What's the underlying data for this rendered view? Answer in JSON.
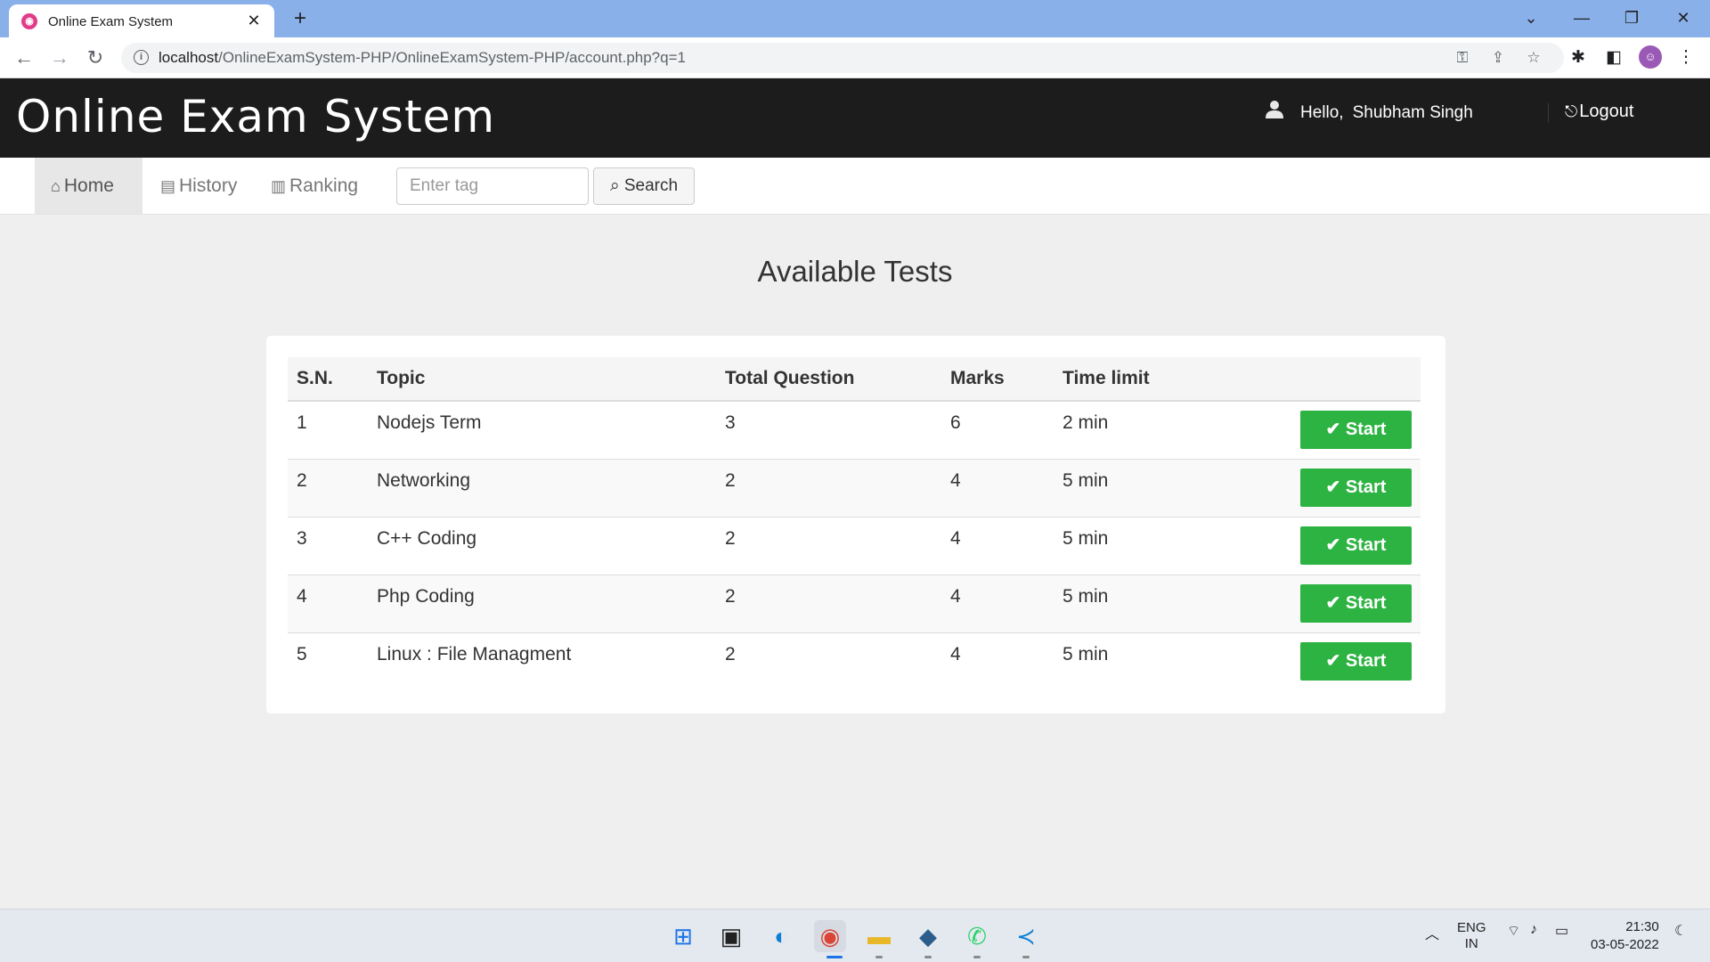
{
  "browser": {
    "tab_title": "Online Exam System",
    "tab_close": "✕",
    "new_tab": "+",
    "url_host": "localhost",
    "url_path": "/OnlineExamSystem-PHP/OnlineExamSystem-PHP/account.php?q=1"
  },
  "header": {
    "logo": "Online Exam System",
    "hello_label": "Hello,",
    "user_name": "Shubham Singh",
    "logout_label": "Logout"
  },
  "nav": {
    "items": [
      {
        "label": "Home",
        "icon": "home-icon",
        "active": true
      },
      {
        "label": "History",
        "icon": "list-icon",
        "active": false
      },
      {
        "label": "Ranking",
        "icon": "bar-chart-icon",
        "active": false
      }
    ],
    "search_placeholder": "Enter tag",
    "search_label": "Search"
  },
  "main": {
    "title": "Available Tests",
    "columns": [
      "S.N.",
      "Topic",
      "Total Question",
      "Marks",
      "Time limit"
    ],
    "start_label": "Start",
    "rows": [
      {
        "sn": "1",
        "topic": "Nodejs Term",
        "total": "3",
        "marks": "6",
        "time": "2 min"
      },
      {
        "sn": "2",
        "topic": "Networking",
        "total": "2",
        "marks": "4",
        "time": "5 min"
      },
      {
        "sn": "3",
        "topic": "C++ Coding",
        "total": "2",
        "marks": "4",
        "time": "5 min"
      },
      {
        "sn": "4",
        "topic": "Php Coding",
        "total": "2",
        "marks": "4",
        "time": "5 min"
      },
      {
        "sn": "5",
        "topic": "Linux : File Managment",
        "total": "2",
        "marks": "4",
        "time": "5 min"
      }
    ]
  },
  "taskbar": {
    "lang_line1": "ENG",
    "lang_line2": "IN",
    "time": "21:30",
    "date": "03-05-2022"
  },
  "colors": {
    "header_bg": "#1c1c1c",
    "start_button": "#2db342",
    "browser_frame": "#8ab0ea"
  }
}
